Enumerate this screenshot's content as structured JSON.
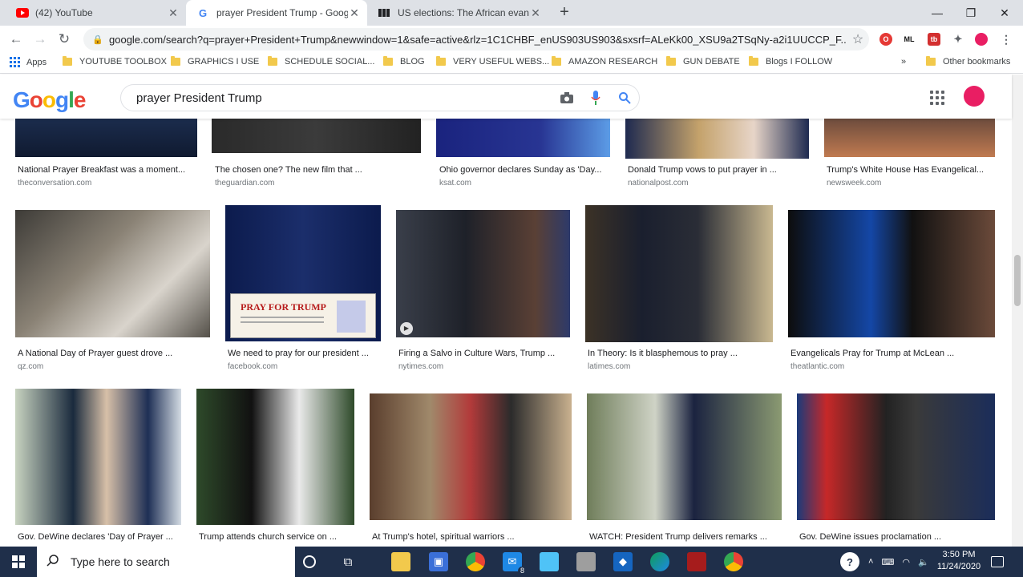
{
  "tabs": [
    {
      "title": "(42) YouTube",
      "icon": "youtube-icon"
    },
    {
      "title": "prayer President Trump - Google",
      "icon": "google-icon"
    },
    {
      "title": "US elections: The African evange",
      "icon": "bbc-icon"
    }
  ],
  "omnibox": {
    "url": "google.com/search?q=prayer+President+Trump&newwindow=1&safe=active&rlz=1C1CHBF_enUS903US903&sxsrf=ALeKk00_XSU9a2TSqNy-a2i1UUCCP_F..."
  },
  "bookmarks": [
    "Apps",
    "YOUTUBE TOOLBOX",
    "GRAPHICS I USE",
    "SCHEDULE SOCIAL...",
    "BLOG",
    "VERY USEFUL WEBS...",
    "AMAZON RESEARCH",
    "GUN DEBATE",
    "Blogs I FOLLOW",
    "»",
    "Other bookmarks"
  ],
  "search": {
    "query": "prayer President Trump"
  },
  "results": {
    "row1": [
      {
        "caption": "National Prayer Breakfast was a moment...",
        "domain": "theconversation.com"
      },
      {
        "caption": "The chosen one? The new film that ...",
        "domain": "theguardian.com"
      },
      {
        "caption": "Ohio governor declares Sunday as 'Day...",
        "domain": "ksat.com"
      },
      {
        "caption": "Donald Trump vows to put prayer in ...",
        "domain": "nationalpost.com"
      },
      {
        "caption": "Trump's White House Has Evangelical...",
        "domain": "newsweek.com"
      }
    ],
    "row2": [
      {
        "caption": "A National Day of Prayer guest drove ...",
        "domain": "qz.com"
      },
      {
        "caption": "We need to pray for our president ...",
        "domain": "facebook.com",
        "overlay": "PRAY FOR TRUMP"
      },
      {
        "caption": "Firing a Salvo in Culture Wars, Trump ...",
        "domain": "nytimes.com"
      },
      {
        "caption": "In Theory: Is it blasphemous to pray ...",
        "domain": "latimes.com"
      },
      {
        "caption": "Evangelicals Pray for Trump at McLean ...",
        "domain": "theatlantic.com"
      }
    ],
    "row3": [
      {
        "caption": "Gov. DeWine declares 'Day of Prayer ..."
      },
      {
        "caption": "Trump attends church service on ..."
      },
      {
        "caption": "At Trump's hotel, spiritual warriors ..."
      },
      {
        "caption": "WATCH: President Trump delivers remarks ..."
      },
      {
        "caption": "Gov. DeWine issues proclamation ..."
      }
    ]
  },
  "taskbar": {
    "search_placeholder": "Type here to search",
    "mail_badge": "8",
    "time": "3:50 PM",
    "date": "11/24/2020"
  }
}
